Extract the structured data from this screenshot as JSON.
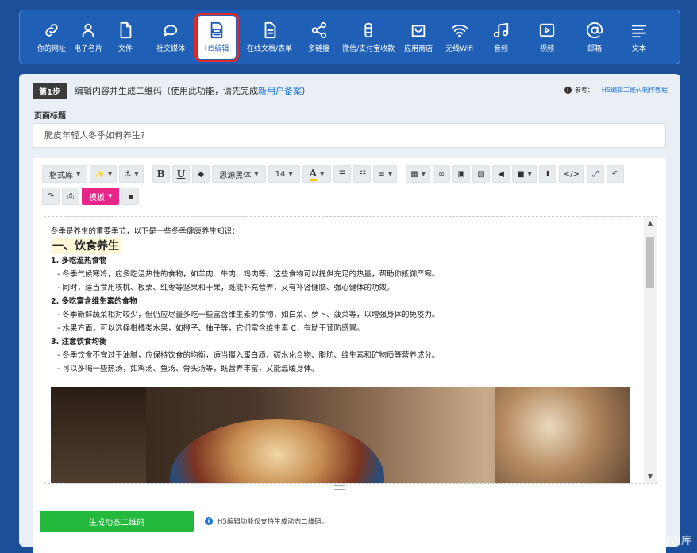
{
  "nav": {
    "items": [
      {
        "label": "你的网址",
        "icon": "link-icon"
      },
      {
        "label": "电子名片",
        "icon": "person-icon"
      },
      {
        "label": "文件",
        "icon": "file-icon"
      },
      {
        "label": "社交媒体",
        "icon": "chat-bubble-icon"
      },
      {
        "label": "H5编辑",
        "icon": "html-file-icon",
        "active": true
      },
      {
        "label": "在线文档/表单",
        "icon": "document-icon"
      },
      {
        "label": "多链接",
        "icon": "share-icon"
      },
      {
        "label": "微信/支付宝收款",
        "icon": "wallet-icon"
      },
      {
        "label": "应用商店",
        "icon": "store-bag-icon"
      },
      {
        "label": "无线Wifi",
        "icon": "wifi-icon"
      },
      {
        "label": "音频",
        "icon": "music-note-icon"
      },
      {
        "label": "视频",
        "icon": "video-play-icon"
      },
      {
        "label": "邮箱",
        "icon": "at-sign-icon"
      },
      {
        "label": "文本",
        "icon": "text-lines-icon"
      }
    ]
  },
  "step": {
    "badge": "第1步",
    "text": "编辑内容并生成二维码（使用此功能，请先完成",
    "link": "新用户备案",
    "text_end": "）",
    "ref_label": "参考：",
    "ref_link": "H5编辑二维码制作教程"
  },
  "page_title": {
    "label": "页面标题",
    "value": "脆皮年轻人冬季如何养生?"
  },
  "toolbar": {
    "format": "格式库",
    "font": "思源黑体",
    "size": "14",
    "template": "模板"
  },
  "content": {
    "intro": "冬季是养生的重要季节，以下是一些冬季健康养生知识：",
    "h1": "一、饮食养生",
    "s1_title": "1. 多吃温热食物",
    "s1_l1": "- 冬季气候寒冷，应多吃温热性的食物，如羊肉、牛肉、鸡肉等，这些食物可以提供充足的热量，帮助你抵御严寒。",
    "s1_l2": "- 同时，适当食用核桃、板栗、红枣等坚果和干果，既能补充营养，又有补肾健脑、强心健体的功效。",
    "s2_title": "2. 多吃富含维生素的食物",
    "s2_l1": "- 冬季新鲜蔬菜相对较少，但仍应尽量多吃一些富含维生素的食物，如白菜、萝卜、菠菜等，以增强身体的免疫力。",
    "s2_l2": "- 水果方面，可以选择柑橘类水果，如橙子、柚子等，它们富含维生素 C，有助于预防感冒。",
    "s3_title": "3. 注意饮食均衡",
    "s3_l1": "- 冬季饮食不宜过于油腻，应保持饮食的均衡，适当摄入蛋白质、碳水化合物、脂肪、维生素和矿物质等营养成分。",
    "s3_l2": "- 可以多喝一些热汤，如鸡汤、鱼汤、骨头汤等，既营养丰富，又能温暖身体。"
  },
  "footer": {
    "button": "生成动态二维码",
    "note": "H5编辑功能仅支持生成动态二维码。"
  },
  "watermark": "CSDN @互联网运营知识库"
}
